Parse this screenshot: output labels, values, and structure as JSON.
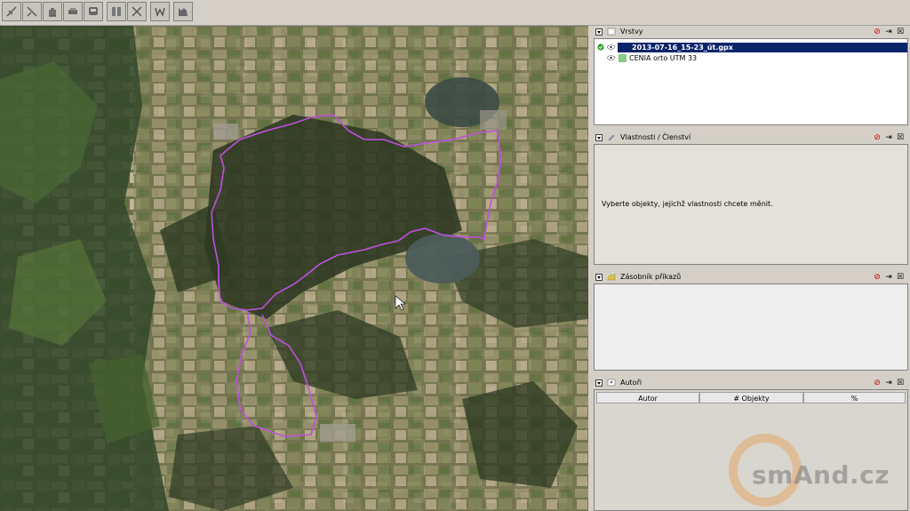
{
  "toolbar": {
    "tools": [
      {
        "name": "select-tool"
      },
      {
        "name": "draw-tool"
      },
      {
        "name": "hand-tool"
      },
      {
        "name": "car-tool"
      },
      {
        "name": "bus-tool"
      },
      {
        "name": "split-tool"
      },
      {
        "name": "delete-tool"
      },
      {
        "name": "wms-tool"
      },
      {
        "name": "imagery-tool"
      }
    ]
  },
  "panels": {
    "layers": {
      "title": "Vrstvy",
      "items": [
        {
          "label": "2013-07-16_15-23_út.gpx",
          "selected": true,
          "active_icon": "check-icon"
        },
        {
          "label": "CENIA orto UTM 33",
          "selected": false
        }
      ]
    },
    "properties": {
      "title": "Vlastnosti / Členství",
      "message": "Vyberte objekty, jejichž vlastnosti chcete měnit."
    },
    "commands": {
      "title": "Zásobník příkazů"
    },
    "authors": {
      "title": "Autoři",
      "columns": [
        "Autor",
        "# Objekty",
        "%"
      ]
    }
  },
  "watermark": {
    "text": "smAnd.cz"
  },
  "colors": {
    "track": "#c050e0",
    "selection": "#0a246a",
    "panel_bg": "#d4d0c8"
  }
}
